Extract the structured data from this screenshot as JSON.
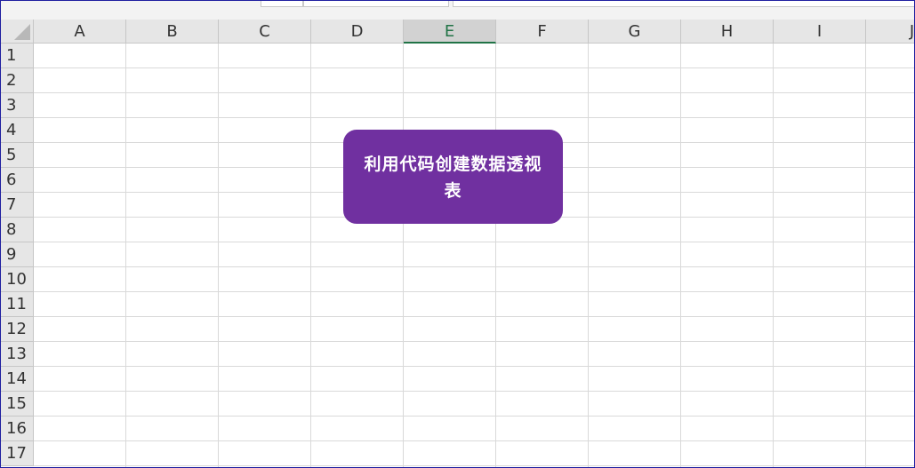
{
  "columns": [
    "A",
    "B",
    "C",
    "D",
    "E",
    "F",
    "G",
    "H",
    "I",
    "J"
  ],
  "selected_column": "E",
  "rows": [
    "1",
    "2",
    "3",
    "4",
    "5",
    "6",
    "7",
    "8",
    "9",
    "10",
    "11",
    "12",
    "13",
    "14",
    "15",
    "16",
    "17"
  ],
  "shape_button": {
    "label": "利用代码创建数据透视表",
    "fill_color": "#7030a0",
    "text_color": "#ffffff"
  },
  "colors": {
    "header_bg": "#e6e6e6",
    "selected_header_bg": "#d2d2d2",
    "selected_accent": "#217346",
    "gridline": "#d9d9d9",
    "frame_border": "#1f1fa0"
  },
  "icons": {
    "select_all": "select-all-triangle-icon"
  }
}
